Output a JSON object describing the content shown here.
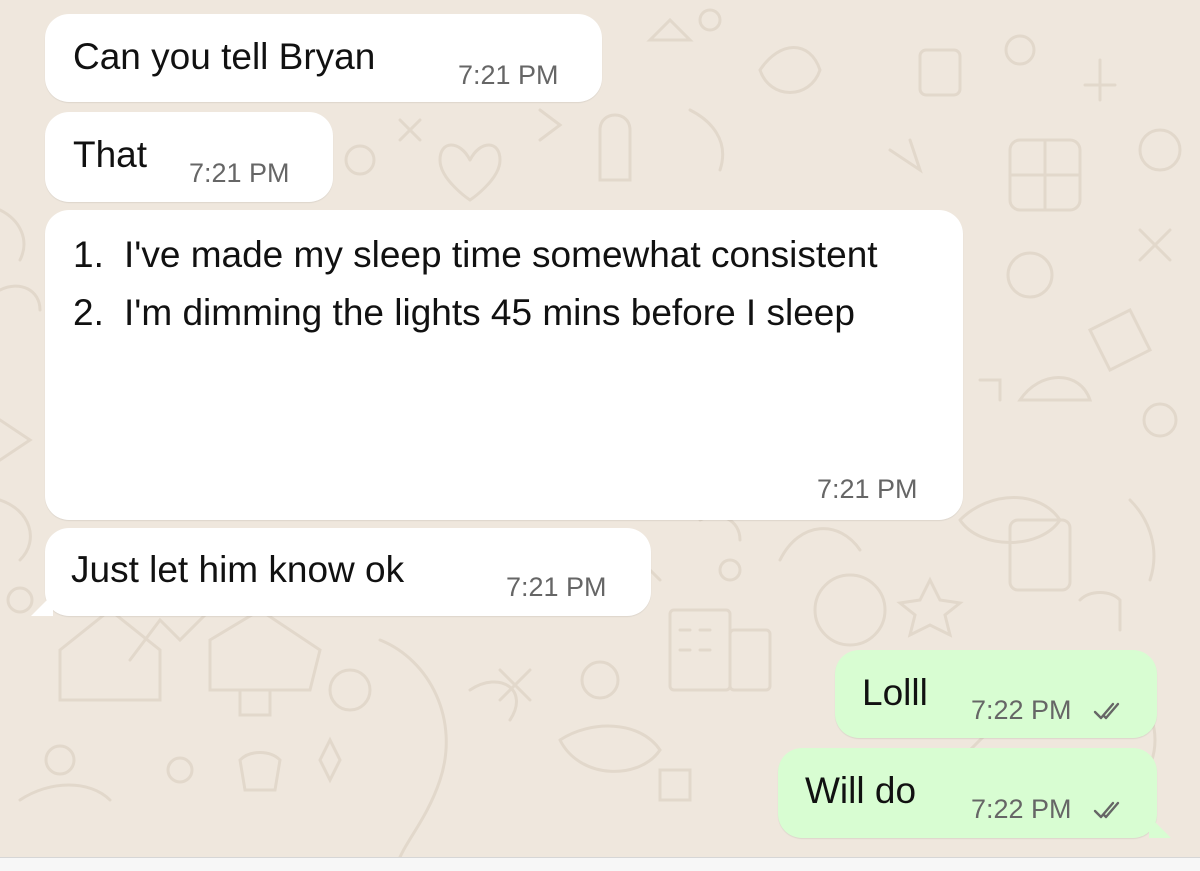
{
  "conversation": {
    "messages": [
      {
        "direction": "incoming",
        "text": "Can you tell Bryan",
        "time": "7:21 PM"
      },
      {
        "direction": "incoming",
        "text": "That",
        "time": "7:21 PM"
      },
      {
        "direction": "incoming",
        "list": [
          {
            "num": "1.",
            "text": "I've made my sleep time somewhat consistent"
          },
          {
            "num": "2.",
            "text": "I'm dimming the lights 45 mins before I sleep"
          }
        ],
        "time": "7:21 PM"
      },
      {
        "direction": "incoming",
        "text": "Just let him know ok",
        "time": "7:21 PM"
      },
      {
        "direction": "outgoing",
        "text": "Lolll",
        "time": "7:22 PM",
        "status": "read"
      },
      {
        "direction": "outgoing",
        "text": "Will do",
        "time": "7:22 PM",
        "status": "read"
      }
    ]
  },
  "colors": {
    "background": "#efe7dd",
    "incoming_bubble": "#ffffff",
    "outgoing_bubble": "#d8fdd2",
    "timestamp": "#666666",
    "read_ticks": "#666666"
  },
  "icons": {
    "read_receipt": "double-check-icon"
  }
}
